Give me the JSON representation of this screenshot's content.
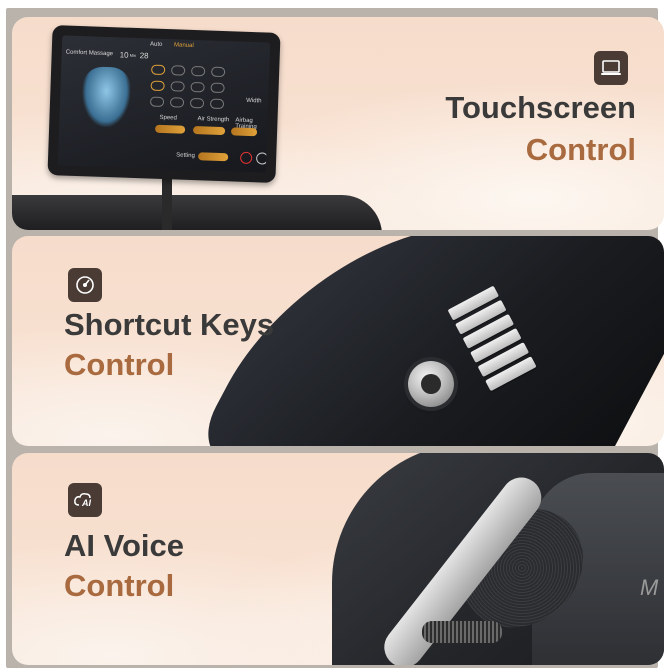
{
  "panels": [
    {
      "title_line1": "Touchscreen",
      "title_line2": "Control",
      "icon": "laptop-icon",
      "screen": {
        "mode_auto": "Auto",
        "mode_manual": "Manual",
        "program": "Comfort Massage",
        "time": "10",
        "time_suffix": "Min",
        "level": "28",
        "speed": "Speed",
        "air_strength": "Air Strength",
        "airbag": "Airbag Training",
        "width": "Width",
        "setting": "Setting"
      }
    },
    {
      "title_line1": "Shortcut Keys",
      "title_line2": "Control",
      "icon": "dial-icon"
    },
    {
      "title_line1": "AI Voice",
      "title_line2": "Control",
      "icon": "ai-voice-icon",
      "brand": "M"
    }
  ],
  "colors": {
    "title_dark": "#3a3a3a",
    "title_accent": "#a86a3e",
    "badge": "#4a3b35",
    "panel_background": "#f6dccb"
  }
}
